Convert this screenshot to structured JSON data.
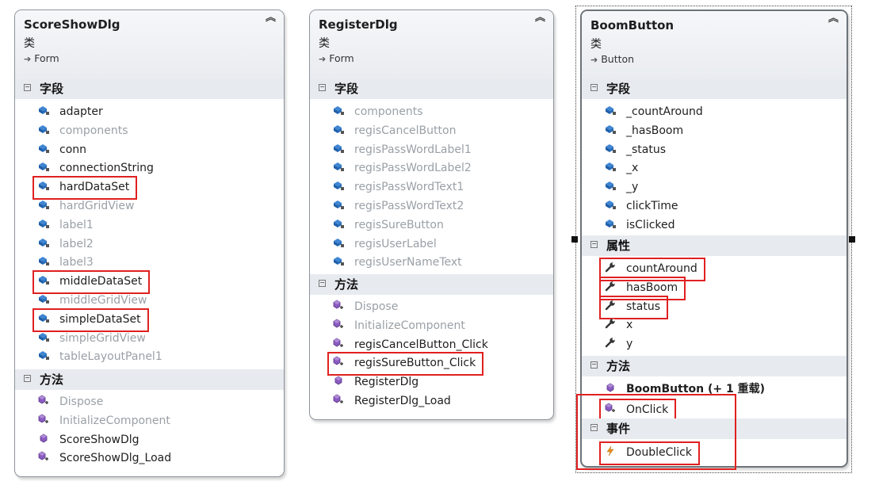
{
  "colors": {
    "highlight": "#e02020",
    "field_icon": "#3478c6",
    "method_icon": "#7b4fa8",
    "event_icon": "#e08a00"
  },
  "cards": [
    {
      "title": "ScoreShowDlg",
      "kind": "类",
      "base": "Form",
      "sections": [
        {
          "label": "字段",
          "items": [
            {
              "name": "adapter",
              "icon": "field-icon",
              "dim": false
            },
            {
              "name": "components",
              "icon": "field-icon",
              "dim": true
            },
            {
              "name": "conn",
              "icon": "field-icon",
              "dim": false
            },
            {
              "name": "connectionString",
              "icon": "field-icon",
              "dim": false
            },
            {
              "name": "hardDataSet",
              "icon": "field-icon",
              "dim": false,
              "highlight": true
            },
            {
              "name": "hardGridView",
              "icon": "field-icon",
              "dim": true
            },
            {
              "name": "label1",
              "icon": "field-icon",
              "dim": true
            },
            {
              "name": "label2",
              "icon": "field-icon",
              "dim": true
            },
            {
              "name": "label3",
              "icon": "field-icon",
              "dim": true
            },
            {
              "name": "middleDataSet",
              "icon": "field-icon",
              "dim": false,
              "highlight": true
            },
            {
              "name": "middleGridView",
              "icon": "field-icon",
              "dim": true
            },
            {
              "name": "simpleDataSet",
              "icon": "field-icon",
              "dim": false,
              "highlight": true
            },
            {
              "name": "simpleGridView",
              "icon": "field-icon",
              "dim": true
            },
            {
              "name": "tableLayoutPanel1",
              "icon": "field-icon",
              "dim": true
            }
          ]
        },
        {
          "label": "方法",
          "items": [
            {
              "name": "Dispose",
              "icon": "protected-method-icon",
              "dim": true
            },
            {
              "name": "InitializeComponent",
              "icon": "protected-method-icon",
              "dim": true
            },
            {
              "name": "ScoreShowDlg",
              "icon": "method-icon",
              "dim": false
            },
            {
              "name": "ScoreShowDlg_Load",
              "icon": "protected-method-icon",
              "dim": false
            }
          ]
        }
      ]
    },
    {
      "title": "RegisterDlg",
      "kind": "类",
      "base": "Form",
      "sections": [
        {
          "label": "字段",
          "items": [
            {
              "name": "components",
              "icon": "field-icon",
              "dim": true
            },
            {
              "name": "regisCancelButton",
              "icon": "field-icon",
              "dim": true
            },
            {
              "name": "regisPassWordLabel1",
              "icon": "field-icon",
              "dim": true
            },
            {
              "name": "regisPassWordLabel2",
              "icon": "field-icon",
              "dim": true
            },
            {
              "name": "regisPassWordText1",
              "icon": "field-icon",
              "dim": true
            },
            {
              "name": "regisPassWordText2",
              "icon": "field-icon",
              "dim": true
            },
            {
              "name": "regisSureButton",
              "icon": "field-icon",
              "dim": true
            },
            {
              "name": "regisUserLabel",
              "icon": "field-icon",
              "dim": true
            },
            {
              "name": "regisUserNameText",
              "icon": "field-icon",
              "dim": true
            }
          ]
        },
        {
          "label": "方法",
          "items": [
            {
              "name": "Dispose",
              "icon": "protected-method-icon",
              "dim": true
            },
            {
              "name": "InitializeComponent",
              "icon": "protected-method-icon",
              "dim": true
            },
            {
              "name": "regisCancelButton_Click",
              "icon": "protected-method-icon",
              "dim": false
            },
            {
              "name": "regisSureButton_Click",
              "icon": "protected-method-icon",
              "dim": false,
              "highlight": true
            },
            {
              "name": "RegisterDlg",
              "icon": "method-icon",
              "dim": false
            },
            {
              "name": "RegisterDlg_Load",
              "icon": "protected-method-icon",
              "dim": false
            }
          ]
        }
      ]
    },
    {
      "title": "BoomButton",
      "kind": "类",
      "base": "Button",
      "sections": [
        {
          "label": "字段",
          "items": [
            {
              "name": "_countAround",
              "icon": "field-icon",
              "dim": false
            },
            {
              "name": "_hasBoom",
              "icon": "field-icon",
              "dim": false
            },
            {
              "name": "_status",
              "icon": "field-icon",
              "dim": false
            },
            {
              "name": "_x",
              "icon": "field-icon",
              "dim": false
            },
            {
              "name": "_y",
              "icon": "field-icon",
              "dim": false
            },
            {
              "name": "clickTime",
              "icon": "field-icon",
              "dim": false
            },
            {
              "name": "isClicked",
              "icon": "field-icon",
              "dim": false
            }
          ]
        },
        {
          "label": "属性",
          "items": [
            {
              "name": "countAround",
              "icon": "wrench-icon",
              "dim": false,
              "highlight": true
            },
            {
              "name": "hasBoom",
              "icon": "wrench-icon",
              "dim": false,
              "highlight": true
            },
            {
              "name": "status",
              "icon": "wrench-icon",
              "dim": false,
              "highlight": true
            },
            {
              "name": "x",
              "icon": "wrench-icon",
              "dim": false
            },
            {
              "name": "y",
              "icon": "wrench-icon",
              "dim": false
            }
          ]
        },
        {
          "label": "方法",
          "items": [
            {
              "name": "BoomButton (+ 1 重载)",
              "icon": "method-icon",
              "dim": false,
              "bold": true
            },
            {
              "name": "OnClick",
              "icon": "protected-method-icon",
              "dim": false,
              "highlight": true
            }
          ]
        },
        {
          "label": "事件",
          "items": [
            {
              "name": "DoubleClick",
              "icon": "event-icon",
              "dim": false,
              "highlight": true
            }
          ]
        }
      ]
    }
  ]
}
